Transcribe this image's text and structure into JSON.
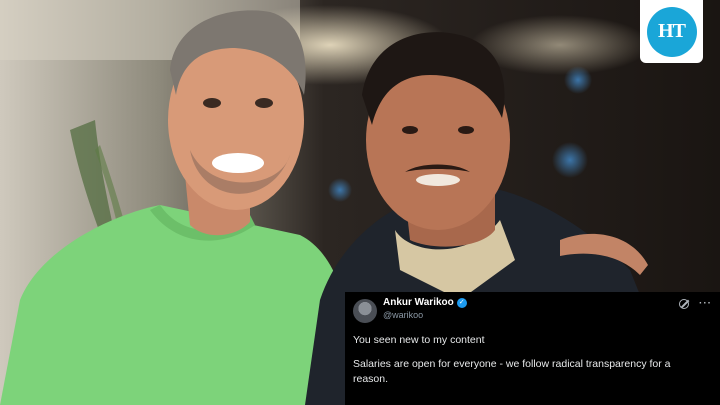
{
  "brand": {
    "logo_text": "HT",
    "logo_color": "#1aa6d8"
  },
  "tweet": {
    "display_name": "Ankur Warikoo",
    "handle": "@warikoo",
    "text_line_1": "You seen new to my content",
    "text_line_2": "Salaries are open for everyone - we follow radical transparency for a reason.",
    "verified_color": "#1d9bf0",
    "icons": [
      "grok-icon",
      "more-icon"
    ]
  },
  "photo": {
    "subjects": [
      "person-left-green-tshirt",
      "person-right-dark-jacket"
    ]
  }
}
